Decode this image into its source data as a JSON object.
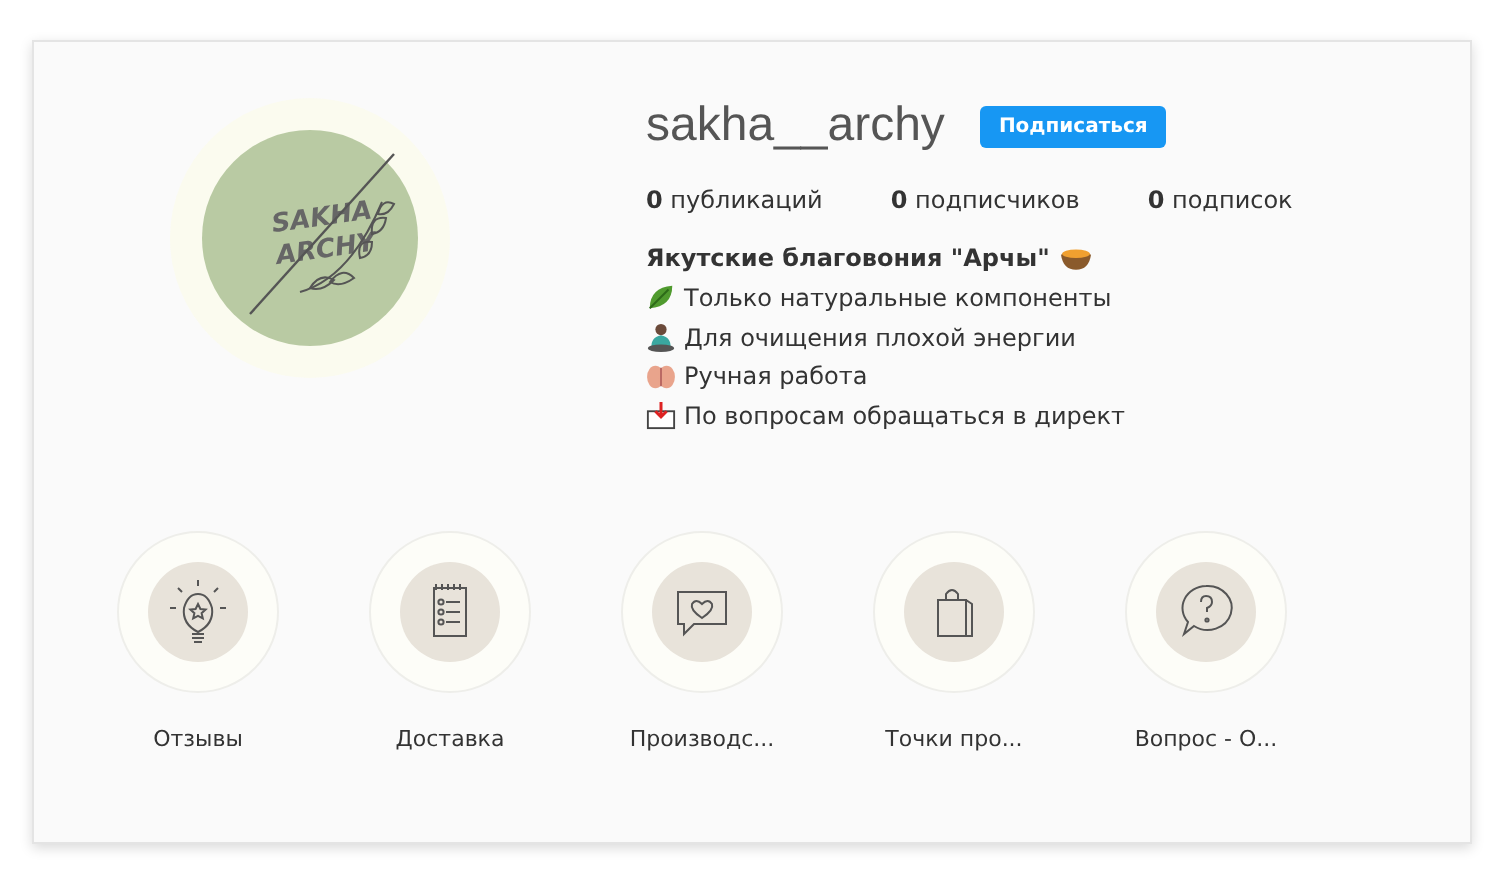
{
  "profile": {
    "logo": [
      "SAKHA",
      "ARCHY"
    ],
    "username": "sakha__archy",
    "follow_button": "Подписаться",
    "stats": [
      {
        "count": "0",
        "label": "публикаций"
      },
      {
        "count": "0",
        "label": "подписчиков"
      },
      {
        "count": "0",
        "label": "подписок"
      }
    ],
    "bio": [
      {
        "text": "Якутские благовония \"Арчы\"",
        "bold": true
      },
      {
        "text": "Только натуральные компоненты",
        "bold": false
      },
      {
        "text": "Для очищения плохой энергии",
        "bold": false
      },
      {
        "text": "Ручная работа",
        "bold": false
      },
      {
        "text": "По вопросам обращаться в директ",
        "bold": false
      }
    ]
  },
  "highlights": [
    {
      "label": "Отзывы"
    },
    {
      "label": "Доставка"
    },
    {
      "label": "Производс..."
    },
    {
      "label": "Точки про..."
    },
    {
      "label": "Вопрос - О..."
    }
  ]
}
